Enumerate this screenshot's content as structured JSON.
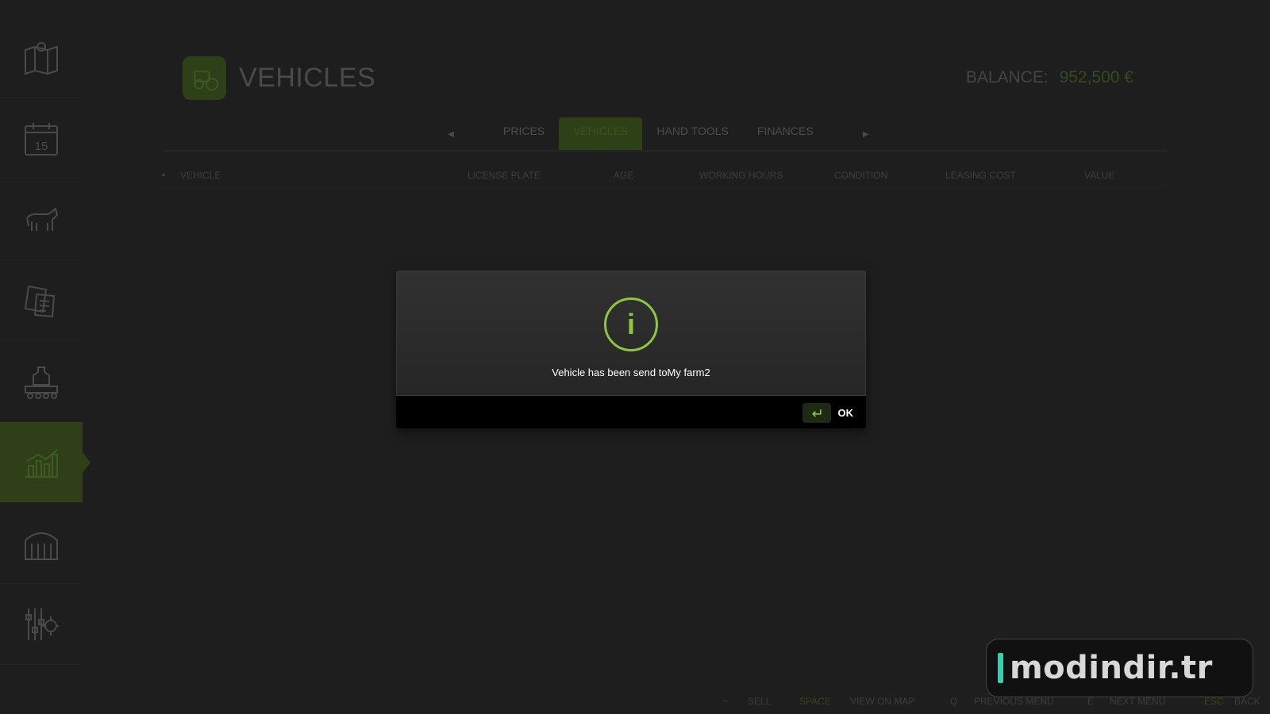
{
  "header": {
    "title": "VEHICLES",
    "balance_label": "BALANCE:",
    "balance_value": "952,500 €"
  },
  "tabs": [
    {
      "label": "PRICES",
      "active": false
    },
    {
      "label": "VEHICLES",
      "active": true
    },
    {
      "label": "HAND TOOLS",
      "active": false
    },
    {
      "label": "FINANCES",
      "active": false
    }
  ],
  "table": {
    "columns": [
      "VEHICLE",
      "LICENSE PLATE",
      "AGE",
      "WORKING HOURS",
      "CONDITION",
      "LEASING COST",
      "VALUE"
    ]
  },
  "sidebar": {
    "items": [
      {
        "icon": "map-icon"
      },
      {
        "icon": "calendar-icon",
        "label": "15"
      },
      {
        "icon": "animals-icon"
      },
      {
        "icon": "contracts-icon"
      },
      {
        "icon": "production-icon"
      },
      {
        "icon": "statistics-icon",
        "active": true
      },
      {
        "icon": "farm-icon"
      },
      {
        "icon": "settings-icon"
      }
    ]
  },
  "dialog": {
    "message": "Vehicle has been send toMy farm2",
    "ok_label": "OK"
  },
  "footer": {
    "hints": [
      {
        "key": "~",
        "label": "SELL"
      },
      {
        "key": "SPACE",
        "label": "VIEW ON MAP"
      },
      {
        "key": "Q",
        "label": "PREVIOUS MENU"
      },
      {
        "key": "E",
        "label": "NEXT MENU"
      },
      {
        "key": "ESC",
        "label": "BACK"
      }
    ]
  },
  "watermark": {
    "text": "modindir.tr"
  },
  "colors": {
    "accent": "#8dc63f",
    "active_bg": "#2f4019",
    "background": "#1e1e1e"
  }
}
